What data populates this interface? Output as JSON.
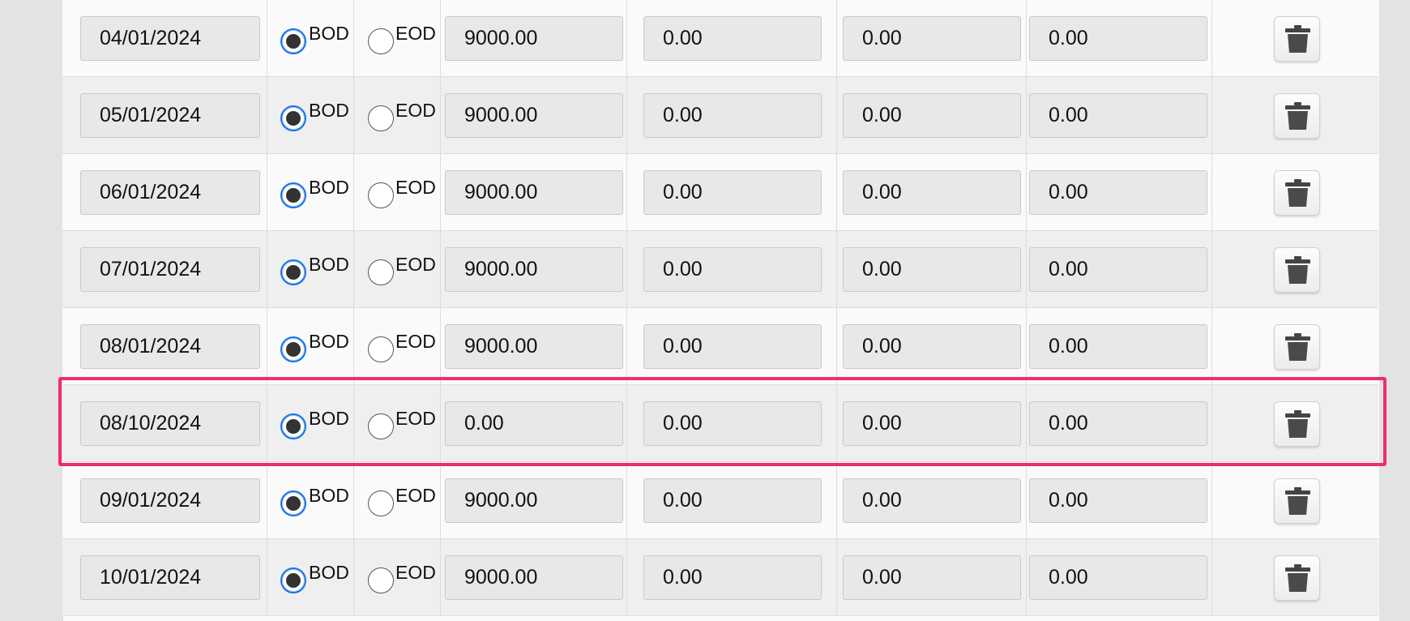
{
  "rows": [
    {
      "date": "04/01/2024",
      "bod_label": "BOD",
      "eod_label": "EOD",
      "selected": "BOD",
      "amount": "9000.00",
      "v1": "0.00",
      "v2": "0.00",
      "v3": "0.00"
    },
    {
      "date": "05/01/2024",
      "bod_label": "BOD",
      "eod_label": "EOD",
      "selected": "BOD",
      "amount": "9000.00",
      "v1": "0.00",
      "v2": "0.00",
      "v3": "0.00"
    },
    {
      "date": "06/01/2024",
      "bod_label": "BOD",
      "eod_label": "EOD",
      "selected": "BOD",
      "amount": "9000.00",
      "v1": "0.00",
      "v2": "0.00",
      "v3": "0.00"
    },
    {
      "date": "07/01/2024",
      "bod_label": "BOD",
      "eod_label": "EOD",
      "selected": "BOD",
      "amount": "9000.00",
      "v1": "0.00",
      "v2": "0.00",
      "v3": "0.00"
    },
    {
      "date": "08/01/2024",
      "bod_label": "BOD",
      "eod_label": "EOD",
      "selected": "BOD",
      "amount": "9000.00",
      "v1": "0.00",
      "v2": "0.00",
      "v3": "0.00"
    },
    {
      "date": "08/10/2024",
      "bod_label": "BOD",
      "eod_label": "EOD",
      "selected": "BOD",
      "amount": "0.00",
      "v1": "0.00",
      "v2": "0.00",
      "v3": "0.00"
    },
    {
      "date": "09/01/2024",
      "bod_label": "BOD",
      "eod_label": "EOD",
      "selected": "BOD",
      "amount": "9000.00",
      "v1": "0.00",
      "v2": "0.00",
      "v3": "0.00"
    },
    {
      "date": "10/01/2024",
      "bod_label": "BOD",
      "eod_label": "EOD",
      "selected": "BOD",
      "amount": "9000.00",
      "v1": "0.00",
      "v2": "0.00",
      "v3": "0.00"
    }
  ],
  "highlighted_row_date": "08/10/2024",
  "colors": {
    "highlight": "#ec2f6b",
    "radio_selected": "#1a73e8"
  },
  "icons": {
    "delete": "trash-icon"
  }
}
